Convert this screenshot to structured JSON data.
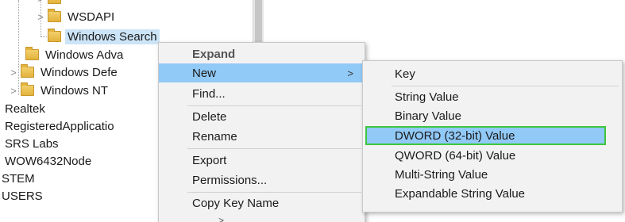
{
  "tree": {
    "items": [
      {
        "label": "WSDAPI",
        "chevron": ">"
      },
      {
        "label": "Windows Search"
      },
      {
        "label": "Windows Adva"
      },
      {
        "label": "Windows Defe",
        "chevron": ">"
      },
      {
        "label": "Windows NT",
        "chevron": ">"
      },
      {
        "label": "Realtek"
      },
      {
        "label": "RegisteredApplicatio"
      },
      {
        "label": "SRS Labs"
      },
      {
        "label": "WOW6432Node"
      },
      {
        "label": "STEM"
      },
      {
        "label": "USERS"
      }
    ]
  },
  "context_menu": {
    "items": [
      {
        "label": "Expand"
      },
      {
        "label": "New",
        "arrow": ">"
      },
      {
        "label": "Find..."
      },
      {
        "label": "Delete"
      },
      {
        "label": "Rename"
      },
      {
        "label": "Export"
      },
      {
        "label": "Permissions..."
      },
      {
        "label": "Copy Key Name"
      }
    ]
  },
  "new_submenu": {
    "items": [
      {
        "label": "Key"
      },
      {
        "label": "String Value"
      },
      {
        "label": "Binary Value"
      },
      {
        "label": "DWORD (32-bit) Value"
      },
      {
        "label": "QWORD (64-bit) Value"
      },
      {
        "label": "Multi-String Value"
      },
      {
        "label": "Expandable String Value"
      }
    ]
  },
  "colors": {
    "menu_background": "#f2f2f2",
    "hover_highlight": "#91c9f7",
    "selection_outline": "#3ec63e",
    "selected_tree_item": "#cce4f7",
    "folder": "#e3b33c"
  },
  "icons": {
    "folder": "folder-icon",
    "expand": "chevron-right-icon",
    "submenu": "submenu-arrow-icon"
  }
}
